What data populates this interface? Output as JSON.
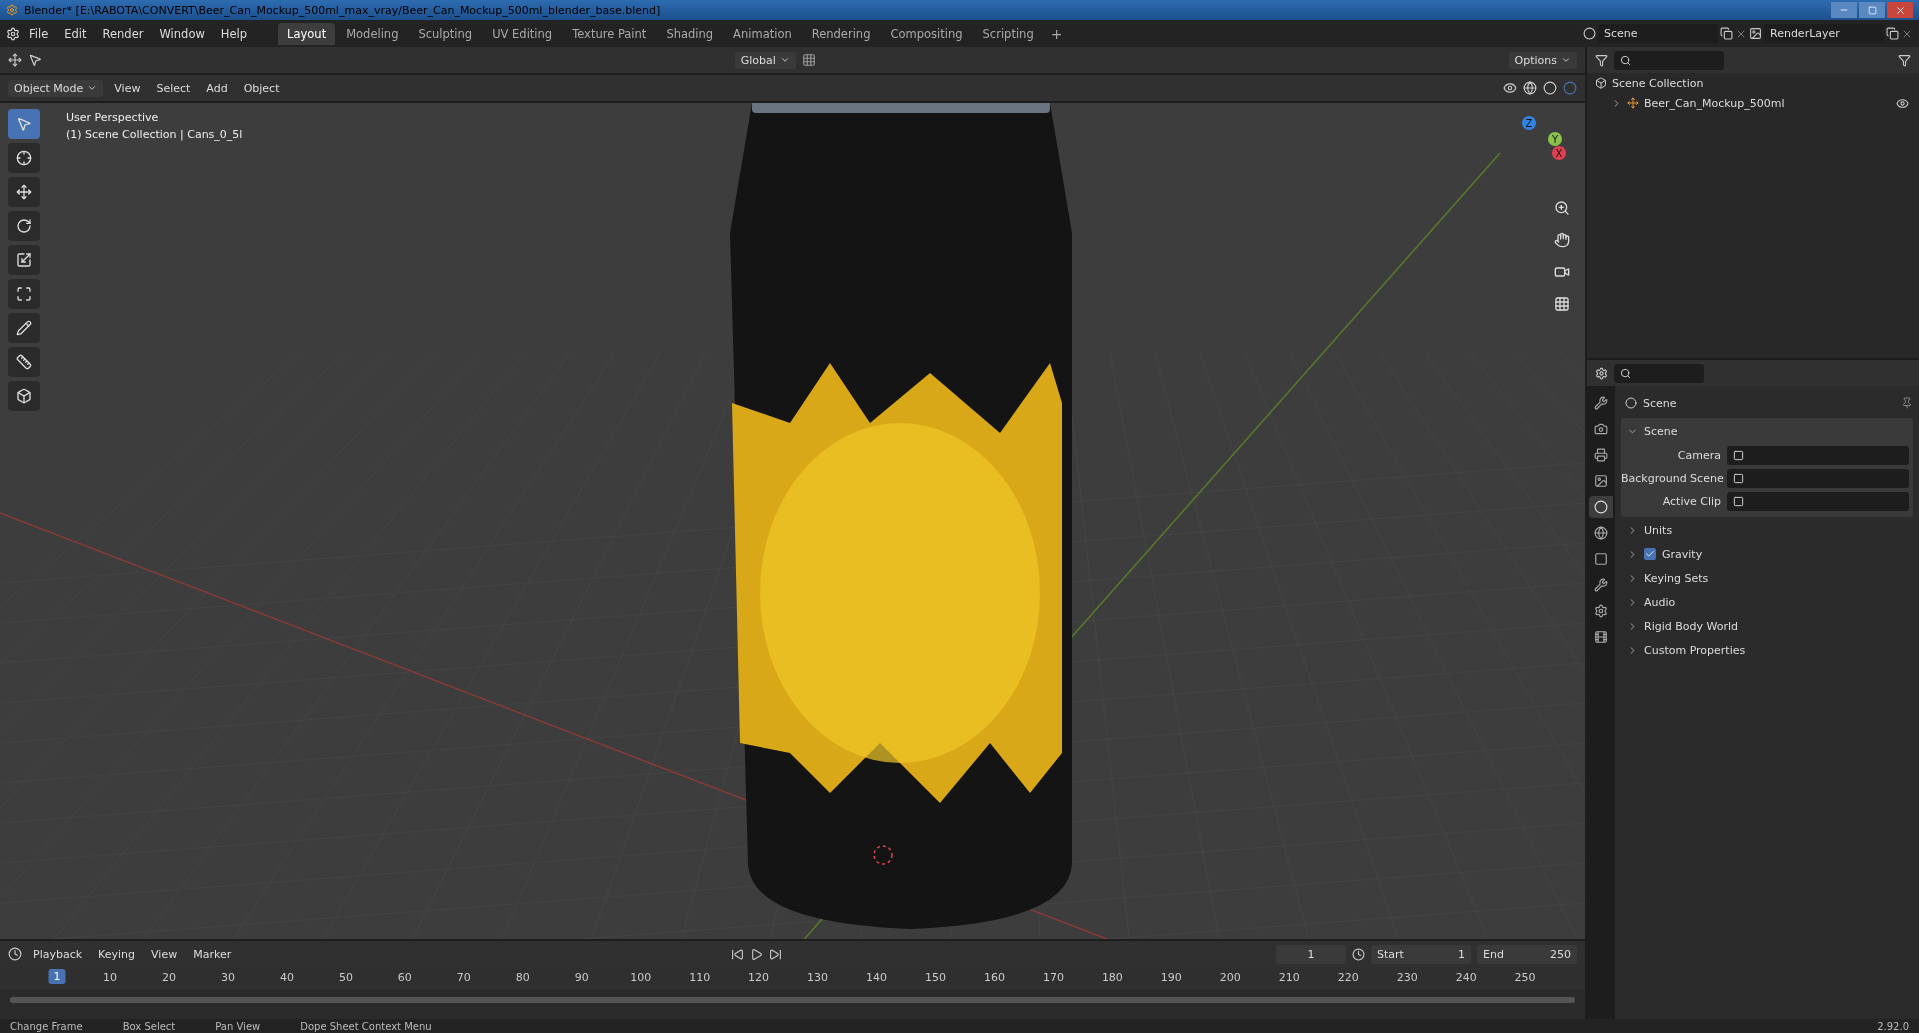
{
  "window": {
    "title": "Blender* [E:\\RABOTA\\CONVERT\\Beer_Can_Mockup_500ml_max_vray/Beer_Can_Mockup_500ml_blender_base.blend]"
  },
  "menu": [
    "File",
    "Edit",
    "Render",
    "Window",
    "Help"
  ],
  "workspaces": [
    {
      "label": "Layout",
      "selected": true
    },
    {
      "label": "Modeling",
      "selected": false
    },
    {
      "label": "Sculpting",
      "selected": false
    },
    {
      "label": "UV Editing",
      "selected": false
    },
    {
      "label": "Texture Paint",
      "selected": false
    },
    {
      "label": "Shading",
      "selected": false
    },
    {
      "label": "Animation",
      "selected": false
    },
    {
      "label": "Rendering",
      "selected": false
    },
    {
      "label": "Compositing",
      "selected": false
    },
    {
      "label": "Scripting",
      "selected": false
    }
  ],
  "add_workspace": "+",
  "scene": "Scene",
  "view_layer": "RenderLayer",
  "tool_header": {
    "orientation": "Global",
    "options": "Options"
  },
  "viewport": {
    "mode": "Object Mode",
    "menus": [
      "View",
      "Select",
      "Add",
      "Object"
    ],
    "info": [
      "User Perspective",
      "(1) Scene Collection | Cans_0_5l"
    ],
    "tools": [
      {
        "kind": "select",
        "selected": true
      },
      {
        "kind": "cursor",
        "selected": false
      },
      {
        "kind": "move",
        "selected": false
      },
      {
        "kind": "rotate",
        "selected": false
      },
      {
        "kind": "scale",
        "selected": false
      },
      {
        "kind": "transform",
        "selected": false
      },
      {
        "kind": "annotate",
        "selected": false
      },
      {
        "kind": "measure",
        "selected": false
      },
      {
        "kind": "add",
        "selected": false
      }
    ],
    "gizmo": [
      "Z",
      "Y",
      "X"
    ]
  },
  "outliner": {
    "root": "Scene Collection",
    "children": [
      {
        "label": "Beer_Can_Mockup_500ml",
        "expanded": false
      }
    ]
  },
  "properties": {
    "tabs": [
      {
        "kind": "tool",
        "selected": false
      },
      {
        "kind": "render",
        "selected": false
      },
      {
        "kind": "output",
        "selected": false
      },
      {
        "kind": "view_layer",
        "selected": false
      },
      {
        "kind": "scene",
        "selected": true
      },
      {
        "kind": "world",
        "selected": false
      },
      {
        "kind": "object",
        "selected": false
      },
      {
        "kind": "modifier",
        "selected": false
      },
      {
        "kind": "physics",
        "selected": false
      },
      {
        "kind": "texture",
        "selected": false
      }
    ],
    "header": "Scene",
    "panel": {
      "title": "Scene",
      "expanded": true,
      "fields": [
        "Camera",
        "Background Scene",
        "Active Clip"
      ]
    },
    "sections": [
      {
        "kind": "plain",
        "label": "Units"
      },
      {
        "kind": "checkbox",
        "label": "Gravity",
        "checked": true
      },
      {
        "kind": "plain",
        "label": "Keying Sets"
      },
      {
        "kind": "plain",
        "label": "Audio"
      },
      {
        "kind": "plain",
        "label": "Rigid Body World"
      },
      {
        "kind": "plain",
        "label": "Custom Properties"
      }
    ]
  },
  "timeline": {
    "menus": [
      "Playback",
      "Keying",
      "View",
      "Marker"
    ],
    "current_frame": "1",
    "start_label": "Start",
    "start": "1",
    "end_label": "End",
    "end": "250",
    "playhead": "1",
    "ruler": [
      "10",
      "20",
      "30",
      "40",
      "50",
      "60",
      "70",
      "80",
      "90",
      "100",
      "110",
      "120",
      "130",
      "140",
      "150",
      "160",
      "170",
      "180",
      "190",
      "200",
      "210",
      "220",
      "230",
      "240",
      "250"
    ]
  },
  "status_bar": {
    "items": [
      "Change Frame",
      "Box Select",
      "Pan View",
      "Dope Sheet Context Menu"
    ],
    "version": "2.92.0"
  }
}
